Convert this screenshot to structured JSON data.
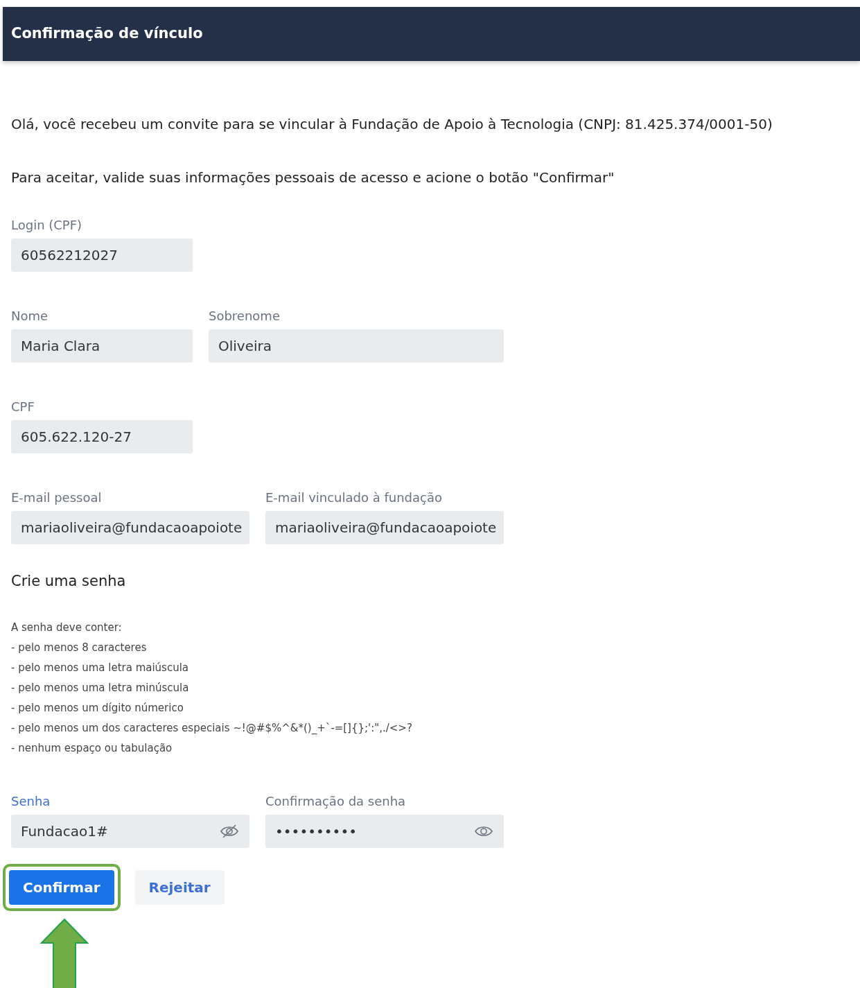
{
  "header": {
    "title": "Confirmação de vínculo"
  },
  "intro": [
    "Olá, você recebeu um convite para se vincular à Fundação de Apoio à Tecnologia (CNPJ: 81.425.374/0001-50)",
    "Para aceitar, valide suas informações pessoais de acesso e acione o botão \"Confirmar\""
  ],
  "field_rows": [
    [
      {
        "label": "Login (CPF)",
        "value": "60562212027"
      }
    ],
    [
      {
        "label": "Nome",
        "value": "Maria Clara"
      },
      {
        "label": "Sobrenome",
        "value": "Oliveira"
      }
    ],
    [
      {
        "label": "CPF",
        "value": "605.622.120-27"
      }
    ],
    [
      {
        "label": "E-mail pessoal",
        "value": "mariaoliveira@fundacaoapoiote"
      },
      {
        "label": "E-mail vinculado à fundação",
        "value": "mariaoliveira@fundacaoapoiote"
      }
    ]
  ],
  "password_section": {
    "title": "Crie uma senha",
    "rules": [
      "A senha deve conter:",
      "- pelo menos 8 caracteres",
      "- pelo menos uma letra maiúscula",
      "- pelo menos uma letra minúscula",
      "- pelo menos um dígito númerico",
      "- pelo menos um dos caracteres especiais ~!@#$%^&*()_+`-=[]{};':\",./<>?",
      "- nenhum espaço ou tabulação"
    ],
    "fields": [
      {
        "label": "Senha",
        "value": "Fundacao1#",
        "focused": true,
        "revealed": true
      },
      {
        "label": "Confirmação da senha",
        "value": "••••••••••",
        "focused": false,
        "revealed": false
      }
    ]
  },
  "buttons": [
    {
      "label": "Confirmar",
      "kind": "primary",
      "highlighted": true
    },
    {
      "label": "Rejeitar",
      "kind": "secondary",
      "highlighted": false
    }
  ]
}
